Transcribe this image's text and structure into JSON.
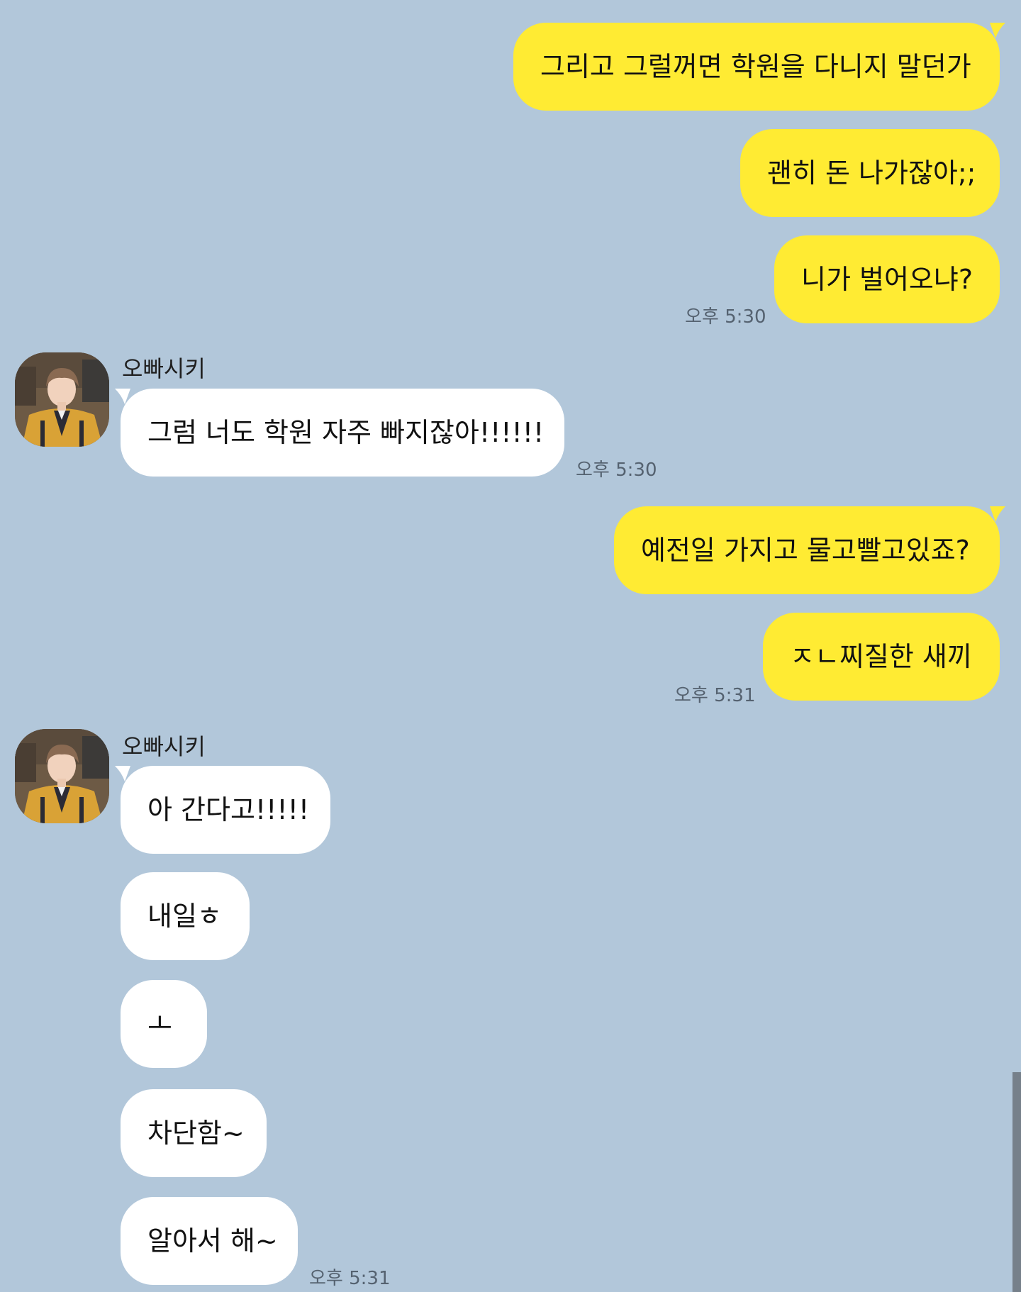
{
  "chat": {
    "contact_name": "오빠시키",
    "colors": {
      "background": "#b2c7da",
      "my_bubble": "#ffeb33",
      "their_bubble": "#ffffff"
    },
    "messages": {
      "m1": "그리고 그럴꺼면 학원을 다니지 말던가",
      "m2": "괜히 돈 나가잖아;;",
      "m3": "니가 벌어오냐?",
      "m4": "그럼 너도 학원 자주 빠지잖아!!!!!!",
      "m5": "예전일 가지고 물고빨고있죠?",
      "m6": "ㅈㄴ찌질한 새끼",
      "m7": "아 간다고!!!!!",
      "m8": "내일ㅎ",
      "m9": "ㅗ",
      "m10": "차단함~",
      "m11": "알아서 해~"
    },
    "timestamps": {
      "t1": "오후 5:30",
      "t2": "오후 5:30",
      "t3": "오후 5:31",
      "t4": "오후 5:31"
    },
    "icons": {
      "avatar": "profile-photo"
    }
  }
}
